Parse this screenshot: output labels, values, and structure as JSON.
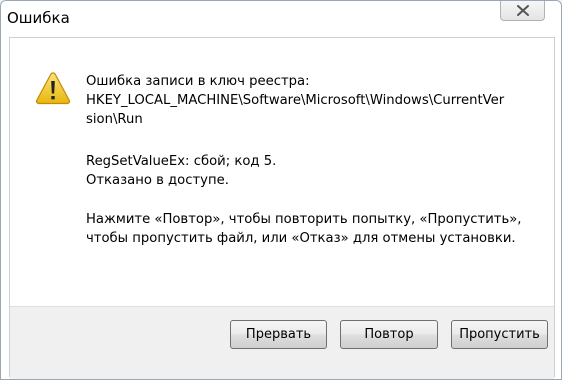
{
  "window": {
    "title": "Ошибка",
    "close_icon": "close-icon"
  },
  "message": {
    "icon": "warning-icon",
    "line1": "Ошибка записи в ключ реестра:",
    "line2": "HKEY_LOCAL_MACHINE\\Software\\Microsoft\\Windows\\CurrentVer",
    "line3": "sion\\Run",
    "line4": "RegSetValueEx: сбой; код 5.",
    "line5": "Отказано в доступе.",
    "line6": "Нажмите «Повтор», чтобы повторить попытку, «Пропустить»,",
    "line7": "чтобы пропустить файл, или «Отказ» для отмены установки."
  },
  "buttons": {
    "abort_label": "Прервать",
    "retry_label": "Повтор",
    "ignore_label": "Пропустить"
  },
  "colors": {
    "warning_yellow": "#f5c518",
    "button_border": "#707070",
    "footer_bg": "#f0f0f0"
  }
}
